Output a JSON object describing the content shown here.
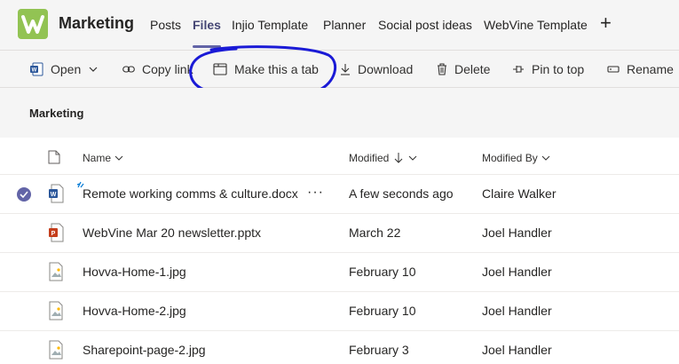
{
  "header": {
    "team_name": "Marketing",
    "tabs": [
      {
        "label": "Posts",
        "active": false
      },
      {
        "label": "Files",
        "active": true
      },
      {
        "label": "Injio Template",
        "active": false
      },
      {
        "label": "Planner",
        "active": false
      },
      {
        "label": "Social post ideas",
        "active": false
      },
      {
        "label": "WebVine Template",
        "active": false
      }
    ],
    "add_tab": "+"
  },
  "toolbar": {
    "open": "Open",
    "copy_link": "Copy link",
    "make_tab": "Make this a tab",
    "download": "Download",
    "delete": "Delete",
    "pin_to_top": "Pin to top",
    "rename": "Rename"
  },
  "section": {
    "title": "Marketing"
  },
  "columns": {
    "name": "Name",
    "modified": "Modified",
    "modified_by": "Modified By"
  },
  "files": [
    {
      "name": "Remote working comms & culture.docx",
      "modified": "A few seconds ago",
      "modified_by": "Claire Walker",
      "type": "word",
      "selected": true,
      "more": "···"
    },
    {
      "name": "WebVine Mar 20 newsletter.pptx",
      "modified": "March 22",
      "modified_by": "Joel Handler",
      "type": "powerpoint"
    },
    {
      "name": "Hovva-Home-1.jpg",
      "modified": "February 10",
      "modified_by": "Joel Handler",
      "type": "image"
    },
    {
      "name": "Hovva-Home-2.jpg",
      "modified": "February 10",
      "modified_by": "Joel Handler",
      "type": "image"
    },
    {
      "name": "Sharepoint-page-2.jpg",
      "modified": "February 3",
      "modified_by": "Joel Handler",
      "type": "image"
    }
  ],
  "colors": {
    "accent": "#6264a7",
    "logo": "#92c353",
    "annotation": "#1a1ad6"
  }
}
